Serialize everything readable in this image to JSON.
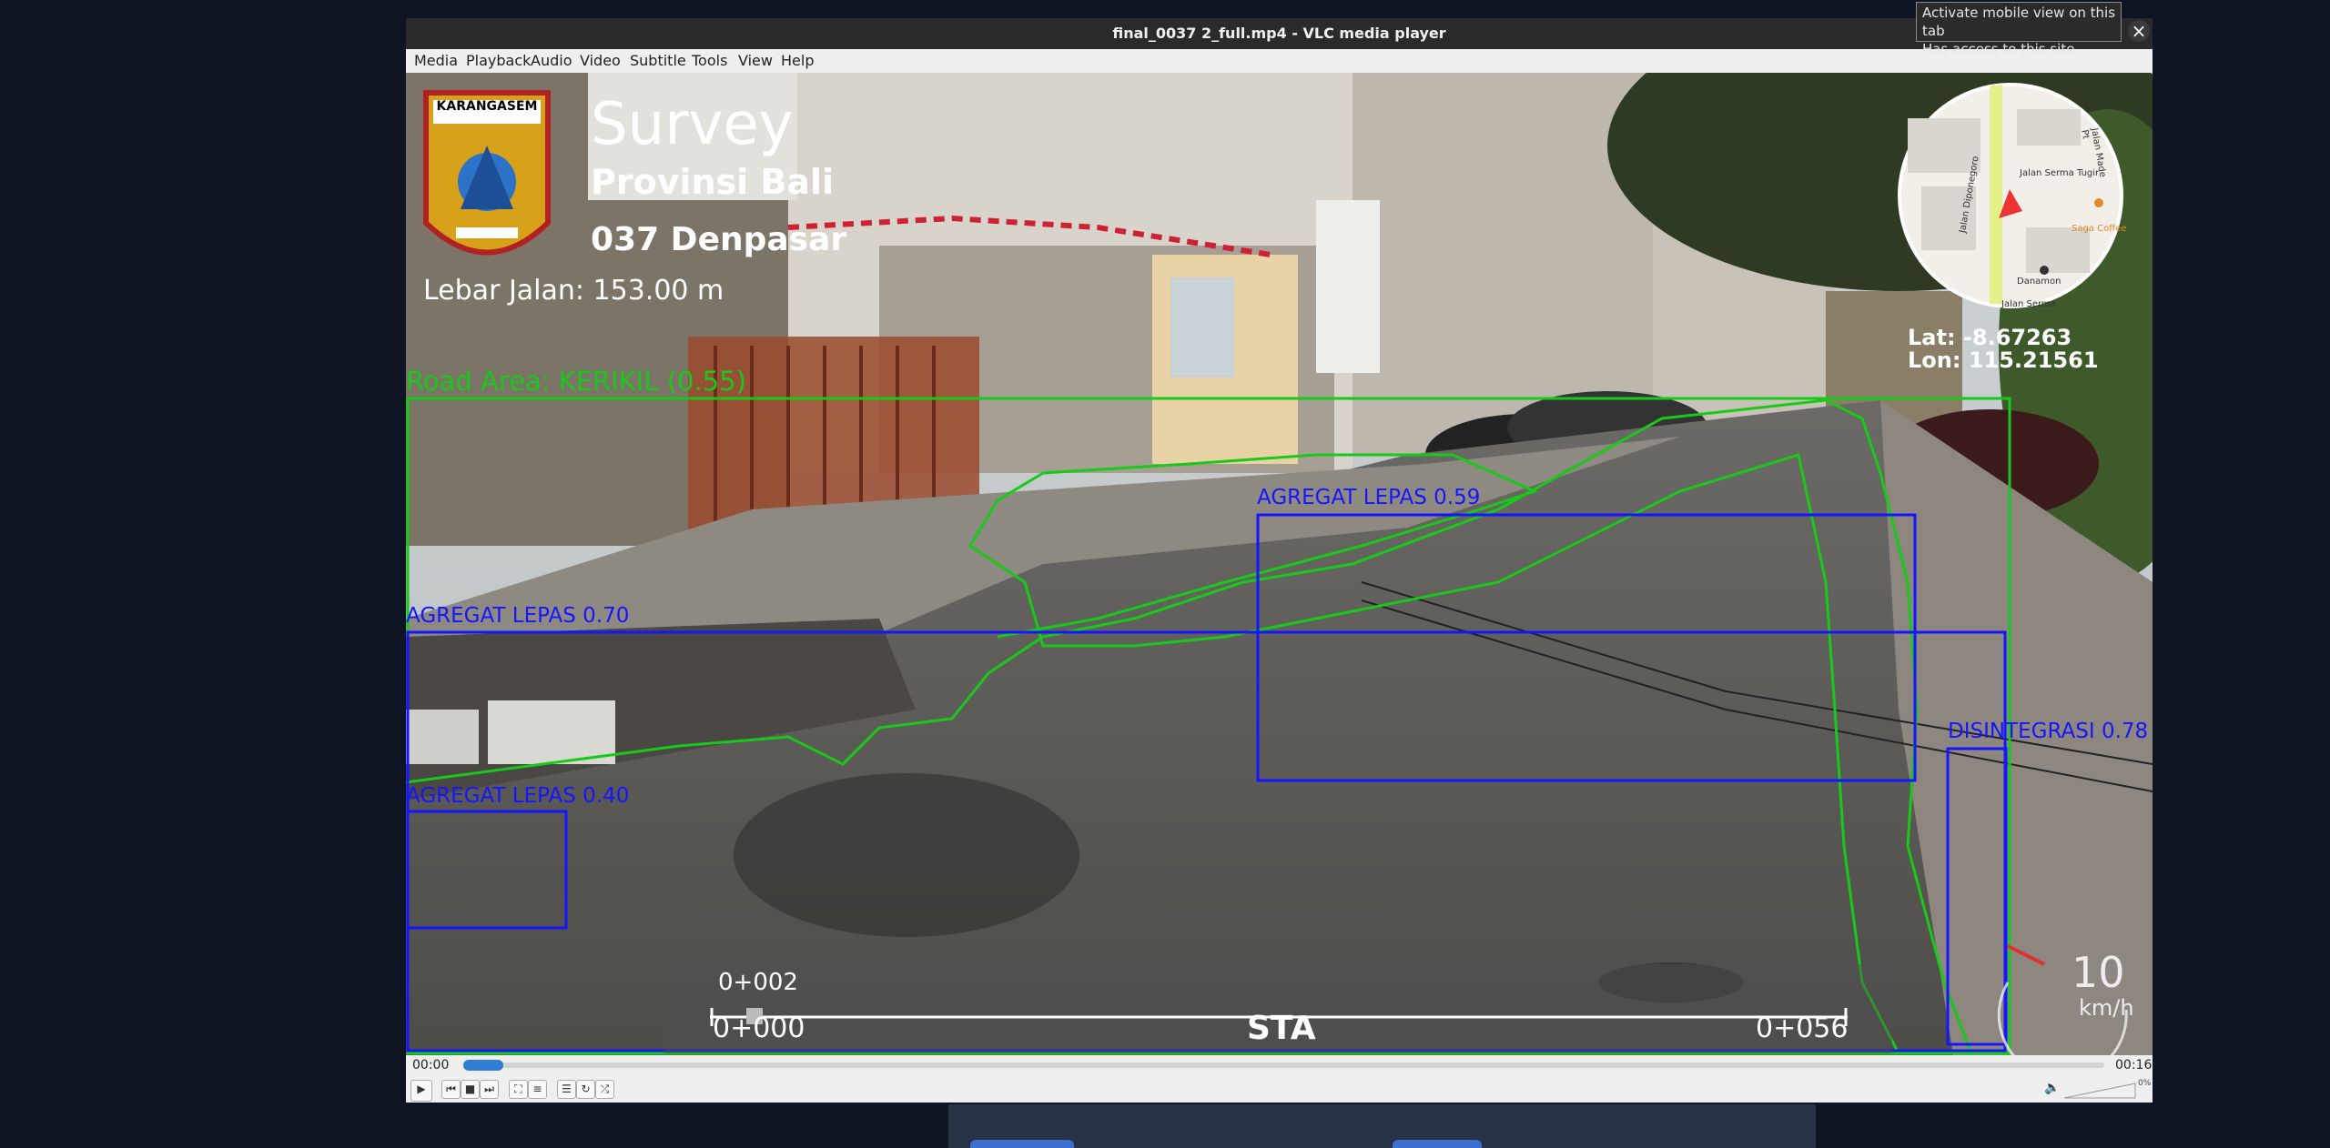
{
  "window": {
    "title": "final_0037 2_full.mp4 - VLC media player"
  },
  "menu": [
    "Media",
    "Playback",
    "Audio",
    "Video",
    "Subtitle",
    "Tools",
    "View",
    "Help"
  ],
  "tooltip": {
    "line1": "Activate mobile view on this tab",
    "line2": "Has access to this site",
    "close_glyph": "×"
  },
  "overlay": {
    "title": "Survey",
    "province": "Provinsi Bali",
    "segment": "037 Denpasar",
    "road_width": "Lebar Jalan: 153.00 m",
    "road_area": "Road Area: KERIKIL (0.55)",
    "logo_text": "KARANGASEM",
    "latitude": "Lat: -8.67263",
    "longitude": "Lon: 115.21561",
    "map_labels": {
      "street1": "Jalan Serma Tugir",
      "street2": "Jalan Diponegoro",
      "street3": "Jalan Serma",
      "street4": "Jalan Made Pt",
      "poi1": "Saga Coffee",
      "poi2": "Danamon"
    },
    "detections": [
      {
        "label": "AGREGAT LEPAS 0.59"
      },
      {
        "label": "AGREGAT LEPAS 0.70"
      },
      {
        "label": "AGREGAT LEPAS 0.40"
      },
      {
        "label": "DISINTEGRASI 0.78"
      }
    ],
    "sta": {
      "current": "0+002",
      "start": "0+000",
      "label": "STA",
      "end": "0+056"
    },
    "speed": {
      "value": "10",
      "unit": "km/h"
    }
  },
  "player": {
    "elapsed": "00:00",
    "total": "00:16",
    "progress_fraction": 0.0,
    "volume": "0%",
    "accent_color": "#2f7fd6"
  },
  "controls": {
    "play_icon": "play-icon",
    "prev_icon": "previous-icon",
    "stop_icon": "stop-icon",
    "next_icon": "next-icon",
    "fullscreen_icon": "fullscreen-icon",
    "extended_icon": "extended-settings-icon",
    "playlist_icon": "playlist-icon",
    "loop_icon": "loop-icon",
    "shuffle_icon": "shuffle-icon"
  },
  "colors": {
    "road_area": "#19c919",
    "detection_box": "#1515ff"
  }
}
